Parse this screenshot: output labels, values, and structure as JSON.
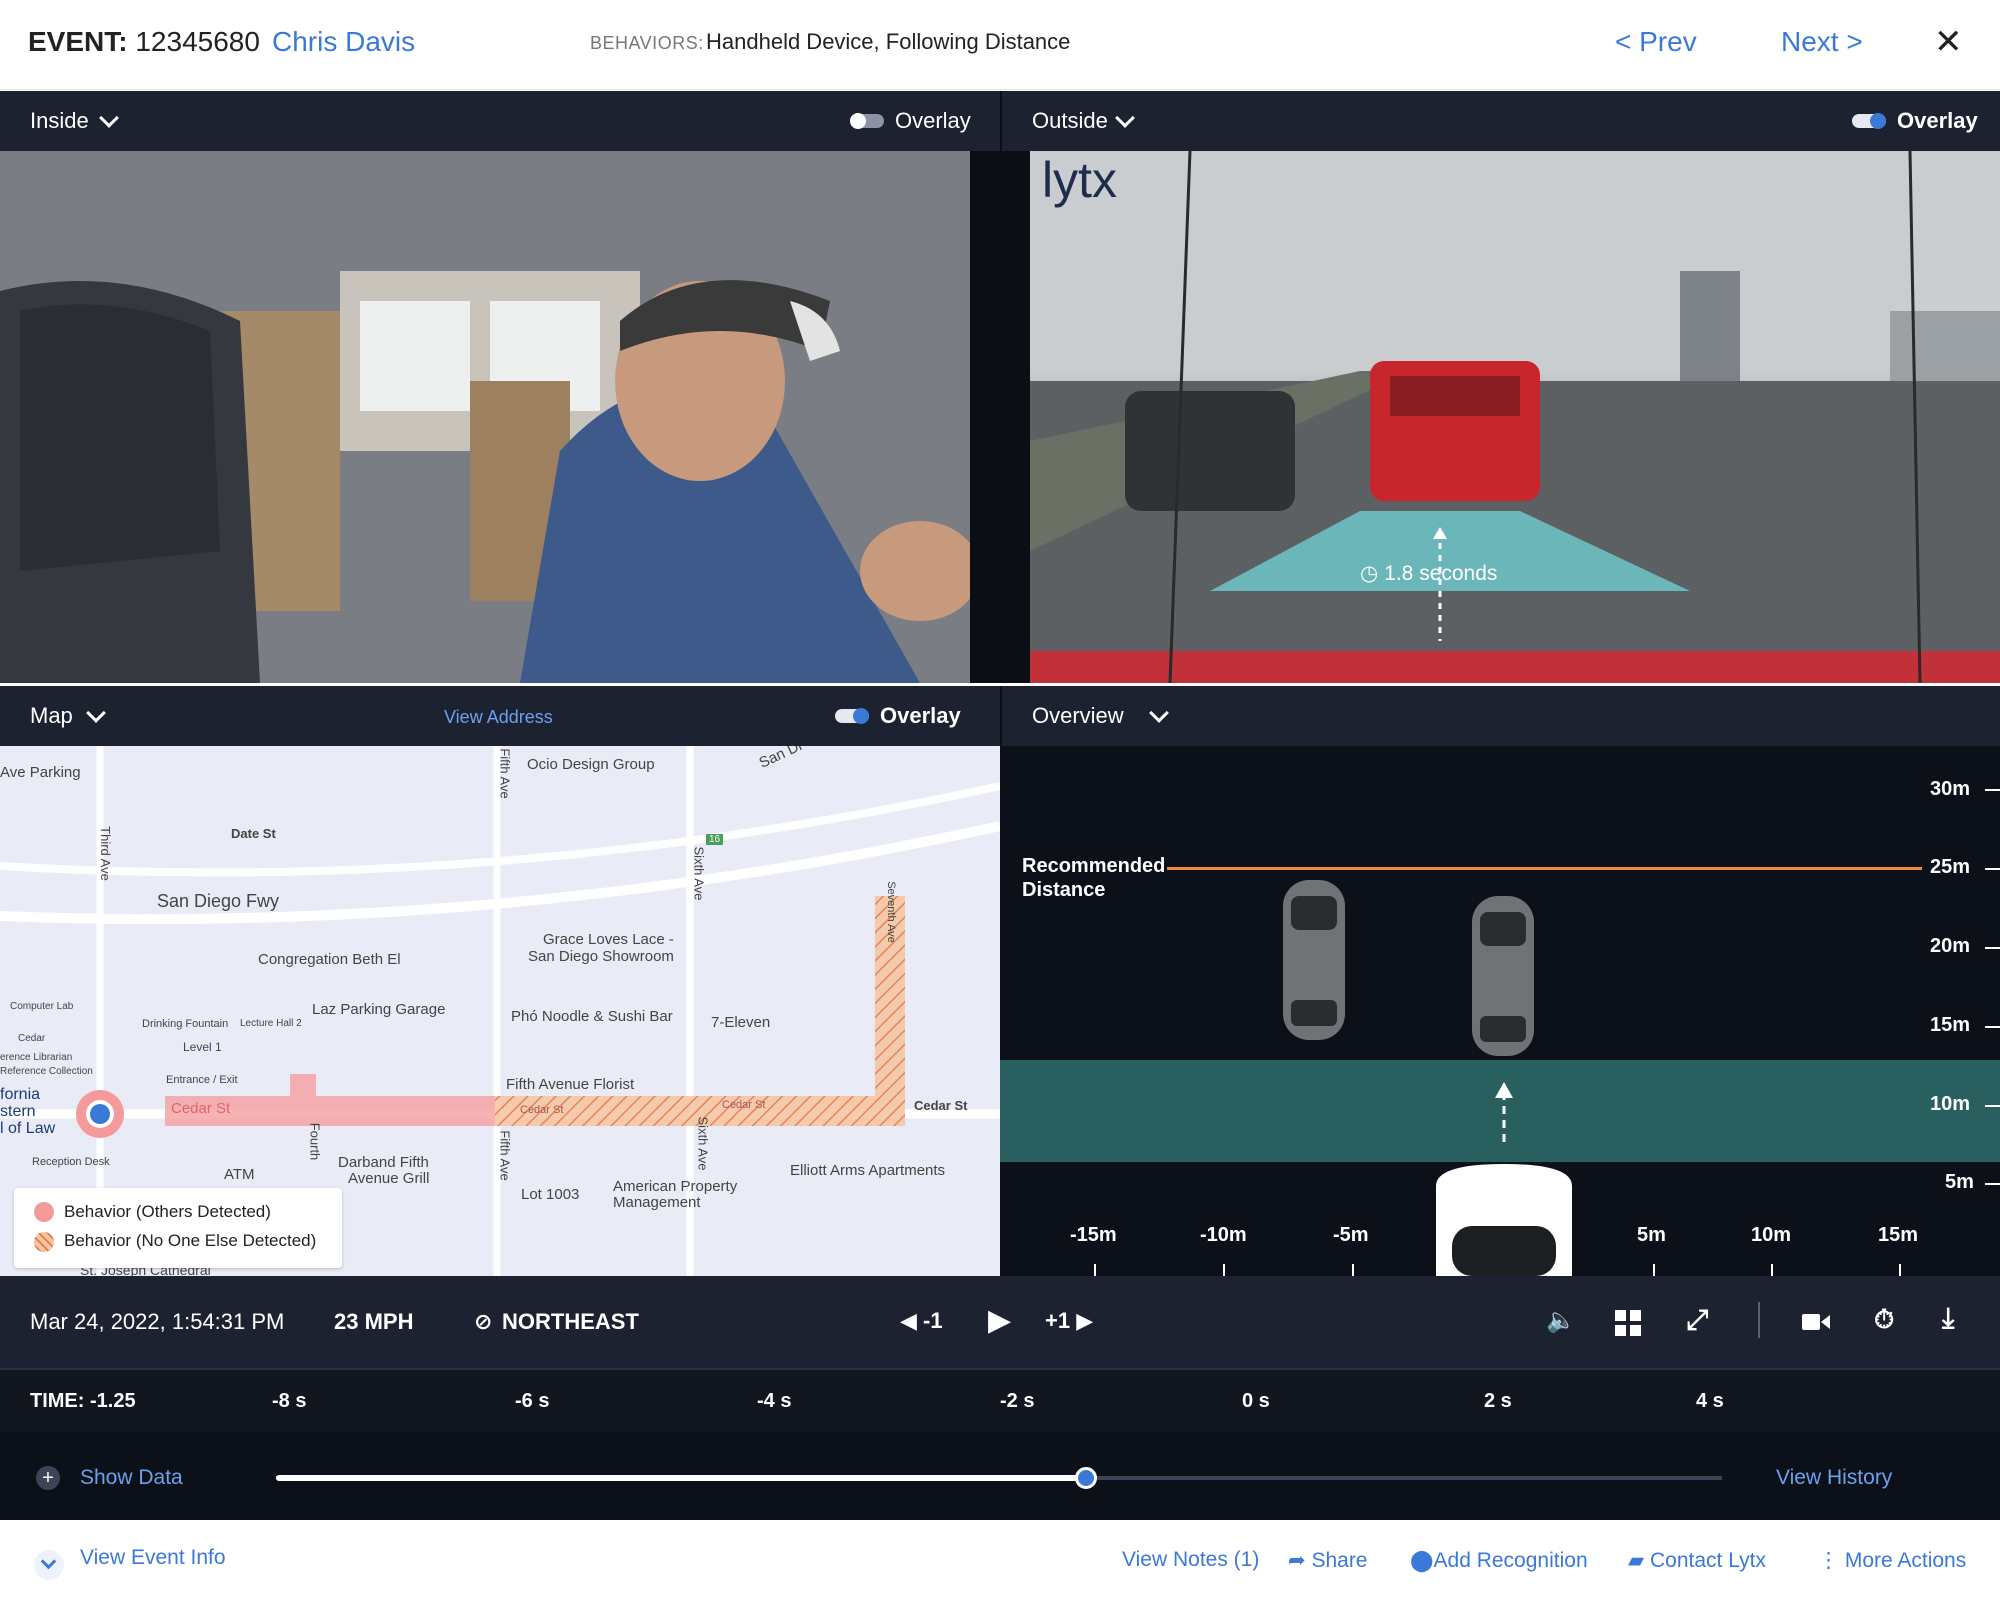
{
  "header": {
    "event_label": "EVENT:",
    "event_id": "12345680",
    "driver": "Chris Davis",
    "behaviors_label": "BEHAVIORS:",
    "behaviors": "Handheld Device, Following Distance",
    "prev": "< Prev",
    "next": "Next >",
    "close": "✕"
  },
  "panels": {
    "inside": {
      "label": "Inside",
      "overlay": "Overlay"
    },
    "outside": {
      "label": "Outside",
      "overlay": "Overlay",
      "watermark": "lytx",
      "following_time": "1.8 seconds"
    },
    "map": {
      "label": "Map",
      "view_address": "View Address",
      "overlay": "Overlay"
    },
    "overview": {
      "label": "Overview"
    }
  },
  "map": {
    "labels": [
      "Ave Parking",
      "Date St",
      "San Diego Fwy",
      "Congregation Beth El",
      "Laz Parking Garage",
      "Grace Loves Lace -",
      "San Diego Showroom",
      "Phó Noodle & Sushi Bar",
      "7-Eleven",
      "Fifth Avenue Florist",
      "Ocio Design Group",
      "San Di",
      "Third Ave",
      "Fifth Ave",
      "Sixth Ave",
      "Seventh Ave",
      "Computer Lab",
      "Cedar",
      "Drinking Fountain",
      "Lecture Hall 2",
      "Level 1",
      "erence Librarian",
      "Reference Collection",
      "Entrance / Exit",
      "fornia",
      "stern",
      "l of Law",
      "Reception Desk",
      "ATM",
      "Fourth",
      "Darband Fifth",
      "Avenue Grill",
      "Cedar St",
      "Cedar St",
      "Cedar St",
      "Cedar St",
      "Fifth Ave",
      "Sixth Ave",
      "Lot 1003",
      "American Property",
      "Management",
      "Elliott Arms Apartments",
      "St. Joseph Cathedral",
      "16"
    ],
    "legend": [
      "Behavior (Others Detected)",
      "Behavior (No One Else Detected)"
    ]
  },
  "overview": {
    "recommended": [
      "Recommended",
      "Distance"
    ],
    "y_scale": [
      "30m",
      "25m",
      "20m",
      "15m",
      "10m",
      "5m"
    ],
    "x_scale": [
      "-15m",
      "-10m",
      "-5m",
      "5m",
      "10m",
      "15m"
    ]
  },
  "controls": {
    "datetime": "Mar 24, 2022, 1:54:31 PM",
    "speed": "23 MPH",
    "heading": "NORTHEAST",
    "step_back": "-1",
    "step_fwd": "+1"
  },
  "timeline": {
    "time": "TIME: -1.25",
    "ticks": [
      "-8 s",
      "-6 s",
      "-4 s",
      "-2 s",
      "0 s",
      "2 s",
      "4 s"
    ],
    "progress": 0.56
  },
  "scrub": {
    "show_data": "Show Data",
    "view_history": "View History"
  },
  "footer": {
    "view_event_info": "View Event Info",
    "view_notes": "View Notes (1)",
    "share": "Share",
    "add_recognition": "Add Recognition",
    "contact": "Contact Lytx",
    "more": "More Actions"
  },
  "colors": {
    "accent": "#3b79d6",
    "bar": "#1c2230",
    "behavior_red": "#f49a9a",
    "behavior_orange": "#f2a070",
    "recommended_line": "#f2883a",
    "lane_zone": "#2a5f60"
  }
}
